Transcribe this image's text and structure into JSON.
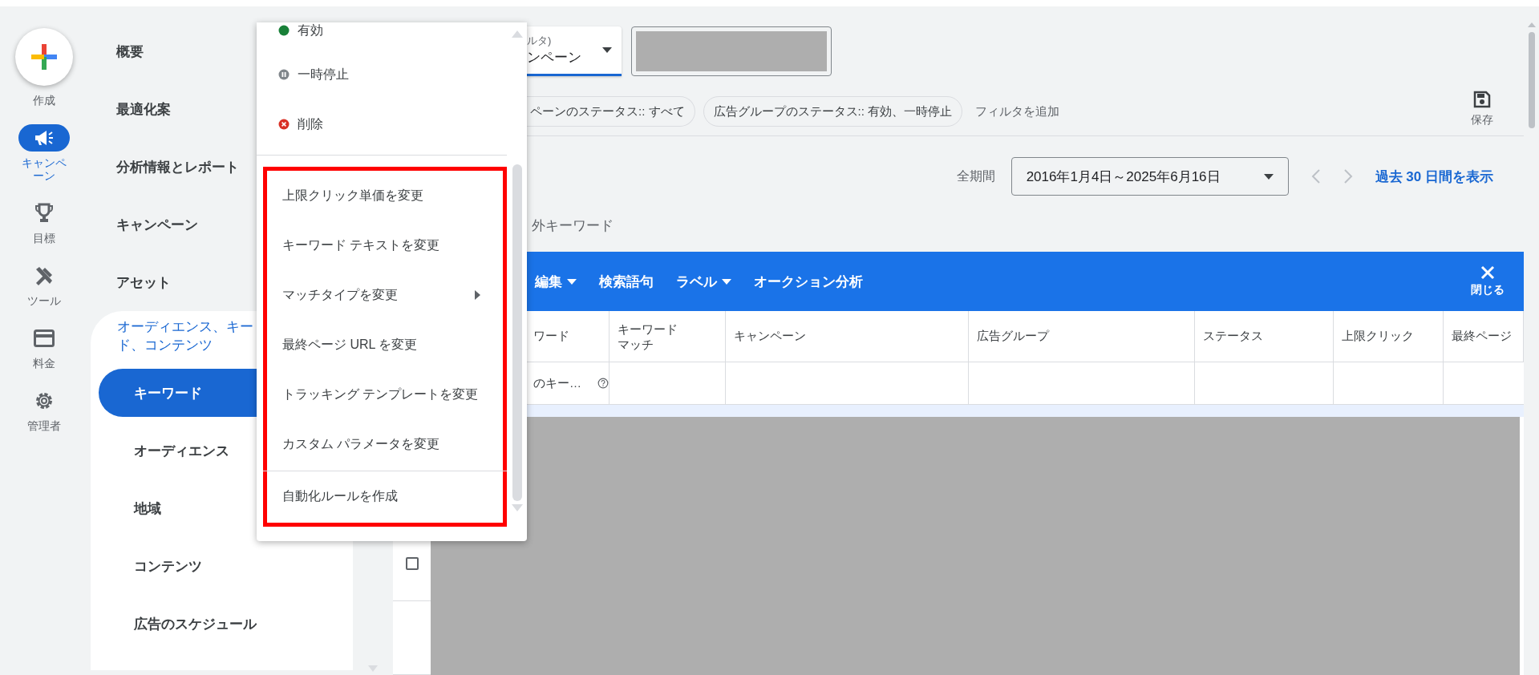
{
  "rail": [
    {
      "label": "作成",
      "kind": "create",
      "selected": false
    },
    {
      "label": "キャンペーン",
      "kind": "campaign",
      "selected": true
    },
    {
      "label": "目標",
      "kind": "goals",
      "selected": false
    },
    {
      "label": "ツール",
      "kind": "tools",
      "selected": false
    },
    {
      "label": "料金",
      "kind": "billing",
      "selected": false
    },
    {
      "label": "管理者",
      "kind": "admin",
      "selected": false
    }
  ],
  "nav": {
    "items": [
      {
        "label": "概要",
        "selected": false
      },
      {
        "label": "最適化案",
        "selected": false
      },
      {
        "label": "分析情報とレポート",
        "selected": false
      },
      {
        "label": "キャンペーン",
        "selected": false
      },
      {
        "label": "アセット",
        "selected": false
      }
    ],
    "section": {
      "title_lines": [
        "オーディエンス、キー",
        "ド、コンテンツ"
      ],
      "children": [
        {
          "label": "キーワード",
          "selected": true
        },
        {
          "label": "オーディエンス",
          "selected": false
        },
        {
          "label": "地域",
          "selected": false
        },
        {
          "label": "コンテンツ",
          "selected": false
        },
        {
          "label": "広告のスケジュール",
          "selected": false
        }
      ]
    }
  },
  "view_dropdown": {
    "label": "ルタ)",
    "value": "ンペーン"
  },
  "filters": [
    {
      "label": "ペーンのステータス:: すべて"
    },
    {
      "label": "広告グループのステータス:: 有効、一時停止"
    }
  ],
  "add_filter": "フィルタを追加",
  "save": "保存",
  "date": {
    "label": "全期間",
    "range": "2016年1月4日～2025年6月16日",
    "show_link": "過去 30 日間を表示"
  },
  "tab_label": "外キーワード",
  "toolbar": {
    "actions": [
      {
        "label": "編集",
        "dropdown": true
      },
      {
        "label": "検索語句",
        "dropdown": false
      },
      {
        "label": "ラベル",
        "dropdown": true
      },
      {
        "label": "オークション分析",
        "dropdown": false
      }
    ],
    "close": "閉じる"
  },
  "table": {
    "columns": [
      "ワード",
      "キーワードマッチ",
      "キャンペーン",
      "広告グループ",
      "ステータス",
      "上限クリック",
      "最終ページ"
    ],
    "filter_cell": "のキー…",
    "rows": [
      {
        "checked": false
      }
    ]
  },
  "menu": {
    "status_items": [
      {
        "label": "有効",
        "kind": "enabled",
        "color": "#188038"
      },
      {
        "label": "一時停止",
        "kind": "paused",
        "color": "#80868b"
      },
      {
        "label": "削除",
        "kind": "removed",
        "color": "#d93025"
      }
    ],
    "sections": [
      [
        {
          "label": "上限クリック単価を変更",
          "submenu": false
        },
        {
          "label": "キーワード テキストを変更",
          "submenu": false
        },
        {
          "label": "マッチタイプを変更",
          "submenu": true
        },
        {
          "label": "最終ページ URL を変更",
          "submenu": false
        },
        {
          "label": "トラッキング テンプレートを変更",
          "submenu": false
        },
        {
          "label": "カスタム パラメータを変更",
          "submenu": false
        }
      ],
      [
        {
          "label": "自動化ルールを作成",
          "submenu": false
        }
      ]
    ]
  }
}
